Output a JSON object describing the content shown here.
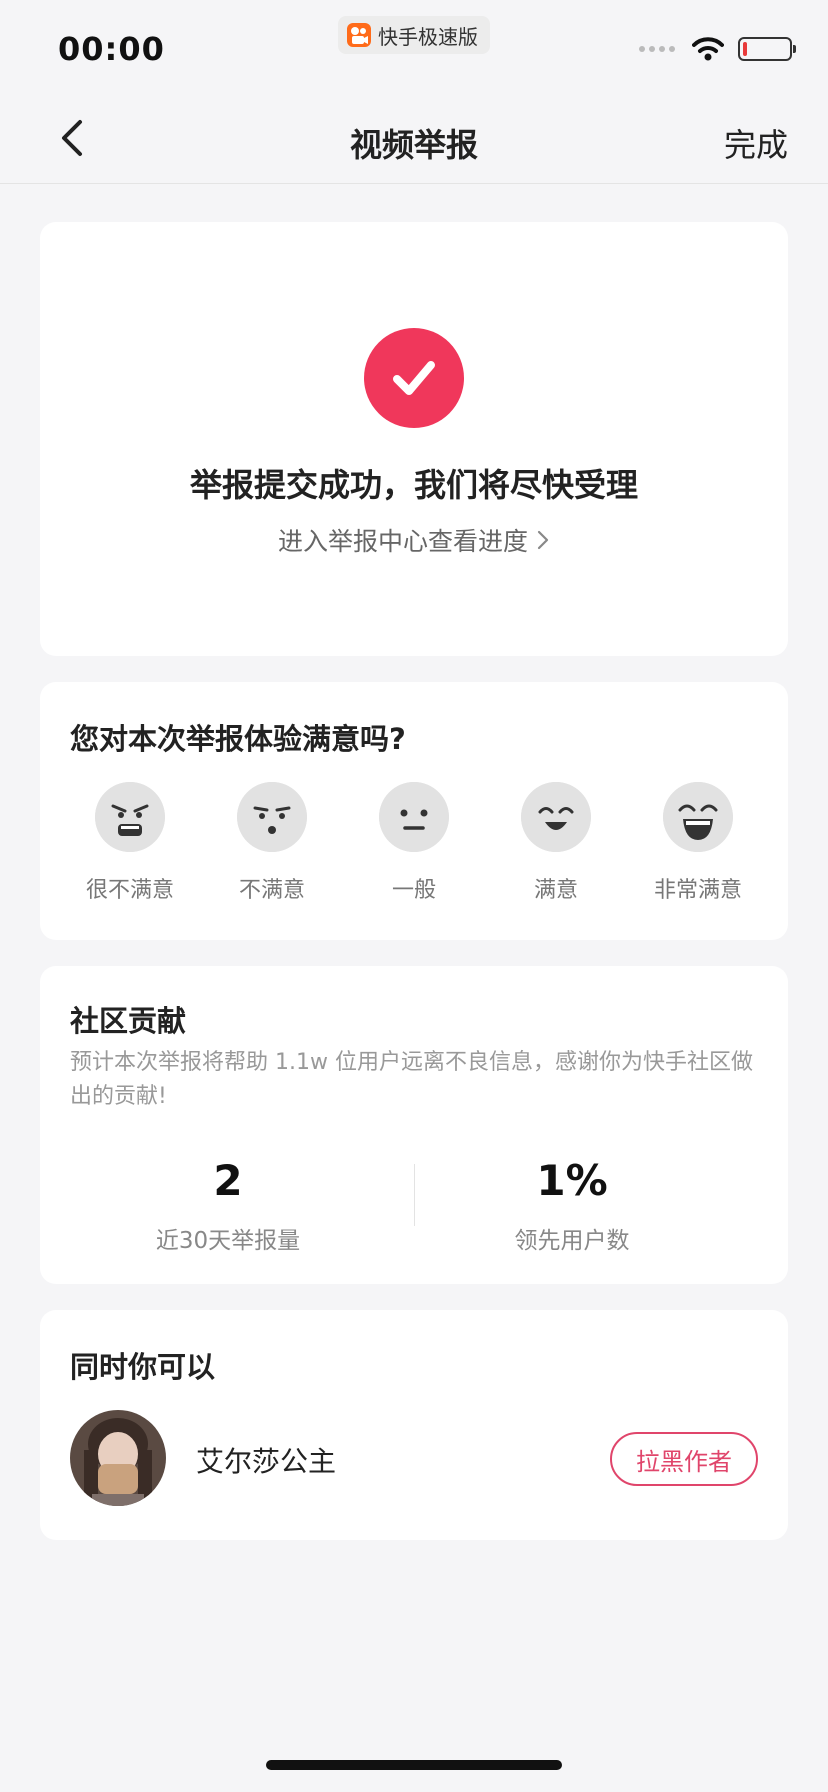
{
  "status_bar": {
    "time": "00:00",
    "app_name": "快手极速版",
    "app_logo": "kuaishou-logo",
    "signal_icon": "signal-icon",
    "wifi_icon": "wifi-icon",
    "battery_icon": "battery-low-icon",
    "battery_fraction": 0.1
  },
  "nav": {
    "back_icon": "chevron-left-icon",
    "title": "视频举报",
    "done_label": "完成"
  },
  "success": {
    "icon": "check-circle-icon",
    "message": "举报提交成功，我们将尽快受理",
    "progress_link": "进入举报中心查看进度",
    "progress_link_icon": "chevron-right-icon"
  },
  "rating": {
    "question": "您对本次举报体验满意吗?",
    "options": [
      {
        "label": "很不满意",
        "icon": "very-dissatisfied-face-icon"
      },
      {
        "label": "不满意",
        "icon": "dissatisfied-face-icon"
      },
      {
        "label": "一般",
        "icon": "neutral-face-icon"
      },
      {
        "label": "满意",
        "icon": "satisfied-face-icon"
      },
      {
        "label": "非常满意",
        "icon": "very-satisfied-face-icon"
      }
    ]
  },
  "contribution": {
    "title": "社区贡献",
    "description": "预计本次举报将帮助 1.1w 位用户远离不良信息，感谢你为快手社区做出的贡献!",
    "stats": [
      {
        "value": "2",
        "label": "近30天举报量"
      },
      {
        "value": "1%",
        "label": "领先用户数"
      }
    ]
  },
  "also": {
    "title": "同时你可以",
    "author_name": "艾尔莎公主",
    "block_label": "拉黑作者"
  },
  "colors": {
    "accent": "#f0375b",
    "block_button": "#e0456b",
    "background": "#f5f5f7",
    "card": "#ffffff",
    "face": "#e2e2e2"
  }
}
